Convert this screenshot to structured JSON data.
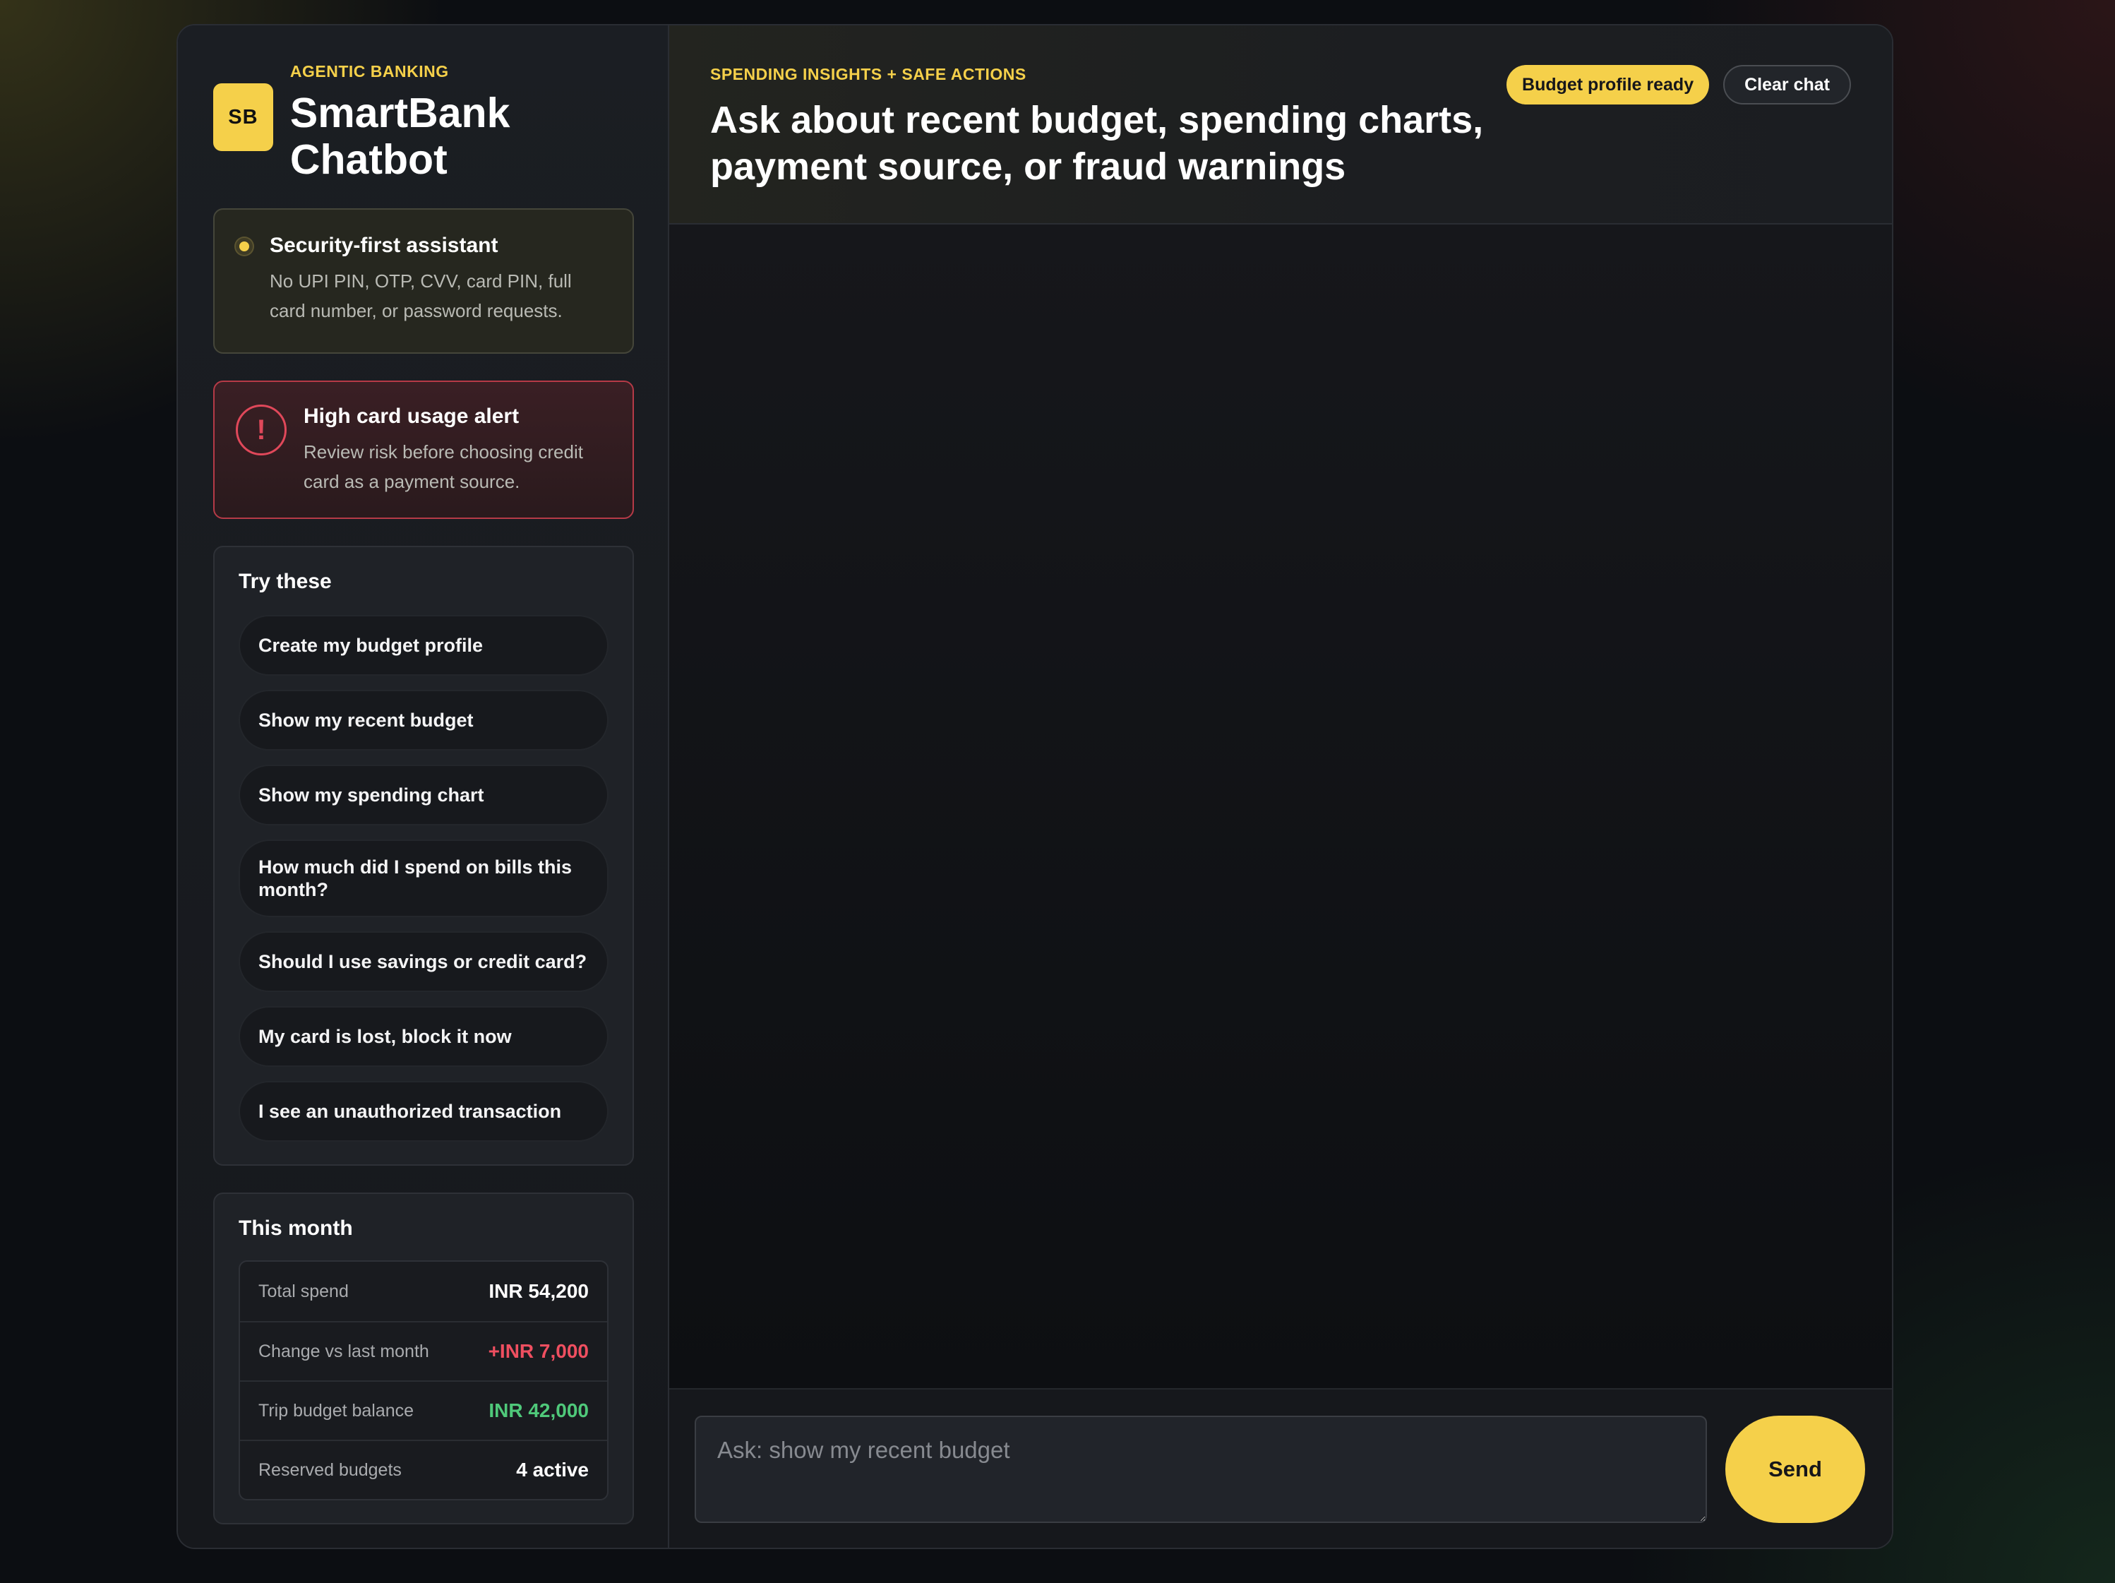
{
  "brand": {
    "logo_text": "SB",
    "eyebrow": "AGENTIC BANKING",
    "title": "SmartBank Chatbot"
  },
  "security_card": {
    "title": "Security-first assistant",
    "description": "No UPI PIN, OTP, CVV, card PIN, full card number, or password requests."
  },
  "alert_card": {
    "icon": "exclamation-icon",
    "icon_glyph": "!",
    "title": "High card usage alert",
    "description": "Review risk before choosing credit card as a payment source."
  },
  "suggestions": {
    "title": "Try these",
    "items": [
      "Create my budget profile",
      "Show my recent budget",
      "Show my spending chart",
      "How much did I spend on bills this month?",
      "Should I use savings or credit card?",
      "My card is lost, block it now",
      "I see an unauthorized transaction"
    ]
  },
  "month_stats": {
    "title": "This month",
    "rows": [
      {
        "label": "Total spend",
        "value": "INR 54,200",
        "tone": "neutral"
      },
      {
        "label": "Change vs last month",
        "value": "+INR 7,000",
        "tone": "negative"
      },
      {
        "label": "Trip budget balance",
        "value": "INR 42,000",
        "tone": "positive"
      },
      {
        "label": "Reserved budgets",
        "value": "4 active",
        "tone": "neutral"
      }
    ]
  },
  "header": {
    "eyebrow": "SPENDING INSIGHTS + SAFE ACTIONS",
    "headline": "Ask about recent budget, spending charts, payment source, or fraud warnings",
    "badge": "Budget profile ready",
    "clear_label": "Clear chat"
  },
  "composer": {
    "placeholder": "Ask: show my recent budget",
    "value": "",
    "send_label": "Send"
  },
  "colors": {
    "accent": "#f5d04a",
    "danger": "#ef4f60",
    "success": "#4fc97a"
  }
}
